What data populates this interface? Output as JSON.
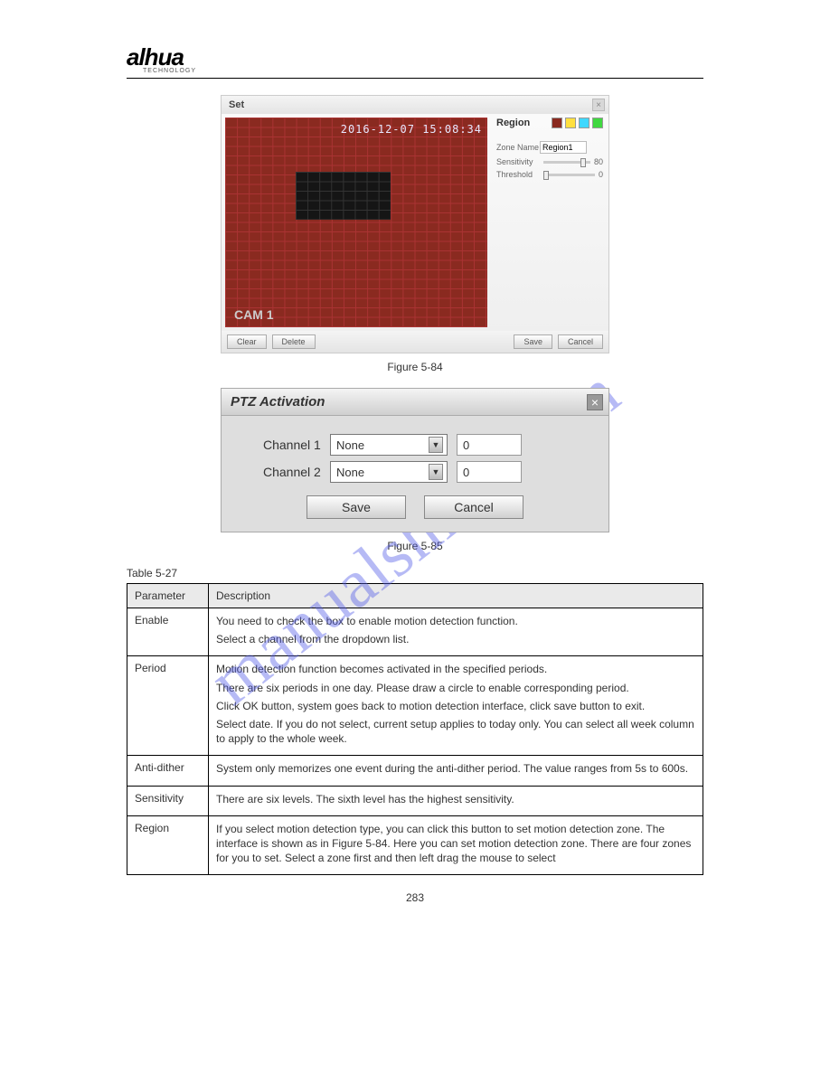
{
  "header": {
    "brand": "alhua",
    "brand_sub": "TECHNOLOGY"
  },
  "watermark": "manualshive.com",
  "set_dialog": {
    "title": "Set",
    "timestamp": "2016-12-07 15:08:34",
    "cam_label": "CAM 1",
    "region_label": "Region",
    "zone_name_label": "Zone Name",
    "zone_name_value": "Region1",
    "sensitivity_label": "Sensitivity",
    "sensitivity_value": "80",
    "threshold_label": "Threshold",
    "threshold_value": "0",
    "btn_clear": "Clear",
    "btn_delete": "Delete",
    "btn_save": "Save",
    "btn_cancel": "Cancel"
  },
  "fig1_caption": "Figure 5-84",
  "ptz": {
    "title": "PTZ Activation",
    "rows": [
      {
        "label": "Channel 1",
        "select": "None",
        "num": "0"
      },
      {
        "label": "Channel 2",
        "select": "None",
        "num": "0"
      }
    ],
    "btn_save": "Save",
    "btn_cancel": "Cancel"
  },
  "fig2_caption": "Figure 5-85",
  "table_caption": "Table 5-27",
  "table": {
    "head_param": "Parameter",
    "head_desc": "Description",
    "rows": [
      {
        "param": "Enable",
        "desc": [
          "You need to check the box to enable motion detection function.",
          "Select a channel from the dropdown list."
        ]
      },
      {
        "param": "Period",
        "desc": [
          "Motion detection function becomes activated in the specified periods.",
          "There are six periods in one day. Please draw a circle to enable corresponding period.",
          "Click OK button, system goes back to motion detection interface, click save button to exit.",
          "Select date. If you do not select, current setup applies to today only. You can select all week column to apply to the whole week."
        ]
      },
      {
        "param": "Anti-dither",
        "desc": [
          "System only memorizes one event during the anti-dither period. The value ranges from 5s to 600s."
        ]
      },
      {
        "param": "Sensitivity",
        "desc": [
          "There are six levels. The sixth level has the highest sensitivity."
        ]
      },
      {
        "param": "Region",
        "desc": [
          "If you select motion detection type, you can click this button to set motion detection zone. The interface is shown as in Figure 5-84. Here you can set motion detection zone. There are four zones for you to set. Select a zone first and then left drag the mouse to select"
        ]
      }
    ]
  },
  "page_number": "283"
}
